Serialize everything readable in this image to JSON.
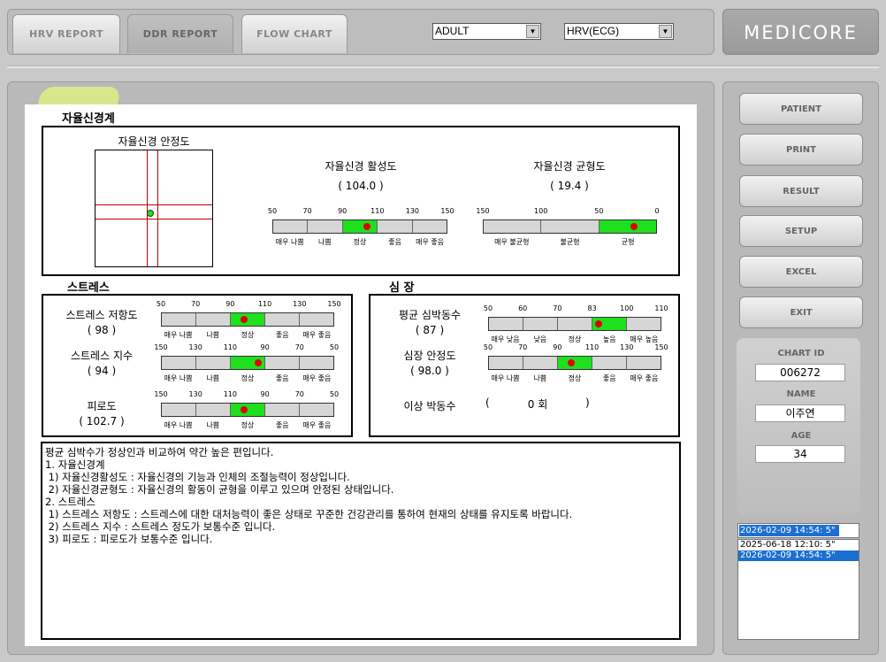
{
  "tabs": [
    {
      "label": "HRV  REPORT"
    },
    {
      "label": "DDR REPORT"
    },
    {
      "label": "FLOW  CHART"
    }
  ],
  "selects": {
    "group": "ADULT",
    "mode": "HRV(ECG)"
  },
  "brand": "MEDICORE",
  "ans": {
    "title": "자율신경계",
    "stability": {
      "label": "자율신경 안정도"
    },
    "activity": {
      "label": "자율신경 활성도",
      "value": "(    104.0    )",
      "ticks": [
        "50",
        "70",
        "90",
        "110",
        "130",
        "150"
      ],
      "cats": [
        "매우 나쁨",
        "나쁨",
        "정상",
        "좋음",
        "매우 좋음"
      ],
      "active_segment": 2,
      "marker": 0.54
    },
    "balance": {
      "label": "자율신경 균형도",
      "value": "(    19.4    )",
      "ticks": [
        "150",
        "100",
        "50",
        "0"
      ],
      "cats": [
        "매우 불균형",
        "불균형",
        "균형"
      ],
      "active_segment": 2,
      "marker": 0.87
    }
  },
  "stress": {
    "title": "스트레스",
    "resistance": {
      "label": "스트레스 저항도",
      "value": "(      98      )",
      "ticks": [
        "50",
        "70",
        "90",
        "110",
        "130",
        "150"
      ],
      "cats": [
        "매우 나쁨",
        "나쁨",
        "정상",
        "좋음",
        "매우 좋음"
      ],
      "active_segment": 2,
      "marker": 0.48
    },
    "index": {
      "label": "스트레스 지수",
      "value": "(      94      )",
      "ticks": [
        "150",
        "130",
        "110",
        "90",
        "70",
        "50"
      ],
      "cats": [
        "매우 나쁨",
        "나쁨",
        "정상",
        "좋음",
        "매우 좋음"
      ],
      "active_segment": 2,
      "marker": 0.56
    },
    "fatigue": {
      "label": "피로도",
      "value": "(  102.7  )",
      "ticks": [
        "150",
        "130",
        "110",
        "90",
        "70",
        "50"
      ],
      "cats": [
        "매우 나쁨",
        "나쁨",
        "정상",
        "좋음",
        "매우 좋음"
      ],
      "active_segment": 2,
      "marker": 0.48
    }
  },
  "heart": {
    "title": "심  장",
    "avg_hr": {
      "label": "평균 심박동수",
      "value": "(      87      )",
      "ticks": [
        "50",
        "60",
        "70",
        "83",
        "100",
        "110"
      ],
      "cats": [
        "매우 낮음",
        "낮음",
        "정상",
        "높음",
        "매우 높음"
      ],
      "active_segment": 3,
      "marker": 0.64
    },
    "stability": {
      "label": "심장 안정도",
      "value": "(  98.0  )",
      "ticks": [
        "50",
        "70",
        "90",
        "110",
        "130",
        "150"
      ],
      "cats": [
        "매우 나쁨",
        "나쁨",
        "정상",
        "좋음",
        "매우 좋음"
      ],
      "active_segment": 2,
      "marker": 0.48
    },
    "arrhythmia": {
      "label": "이상 박동수",
      "open": "(",
      "value": "0 회",
      "close": ")"
    }
  },
  "comments": [
    "평균 심박수가 정상인과 비교하여 약간 높은 편입니다.",
    "1. 자율신경계",
    " 1) 자율신경활성도 : 자율신경의 기능과 인체의 조절능력이 정상입니다.",
    " 2) 자율신경균형도 : 자율신경의 활동이 균형을 이루고 있으며 안정된 상태입니다.",
    "2. 스트레스",
    " 1) 스트레스 저항도 : 스트레스에 대한 대처능력이 좋은 상태로 꾸준한 건강관리를 통하여 현재의 상태를 유지토록 바랍니다.",
    " 2) 스트레스 지수 : 스트레스 정도가 보통수준 입니다.",
    " 3) 피로도 : 피로도가 보통수준 입니다."
  ],
  "sidebar": {
    "buttons": [
      "PATIENT",
      "PRINT",
      "RESULT",
      "SETUP",
      "EXCEL",
      "EXIT"
    ],
    "chart_id_label": "CHART ID",
    "chart_id": "006272",
    "name_label": "NAME",
    "name": "이주연",
    "age_label": "AGE",
    "age": "34",
    "date_selected": "2026-02-09 14:54:  5\"",
    "dates": [
      "2025-06-18 12:10:  5\"",
      "2026-02-09 14:54:  5\""
    ]
  },
  "colors": {
    "active": "#1ee01e",
    "marker": "#e00000",
    "selection": "#1c6fd1"
  }
}
